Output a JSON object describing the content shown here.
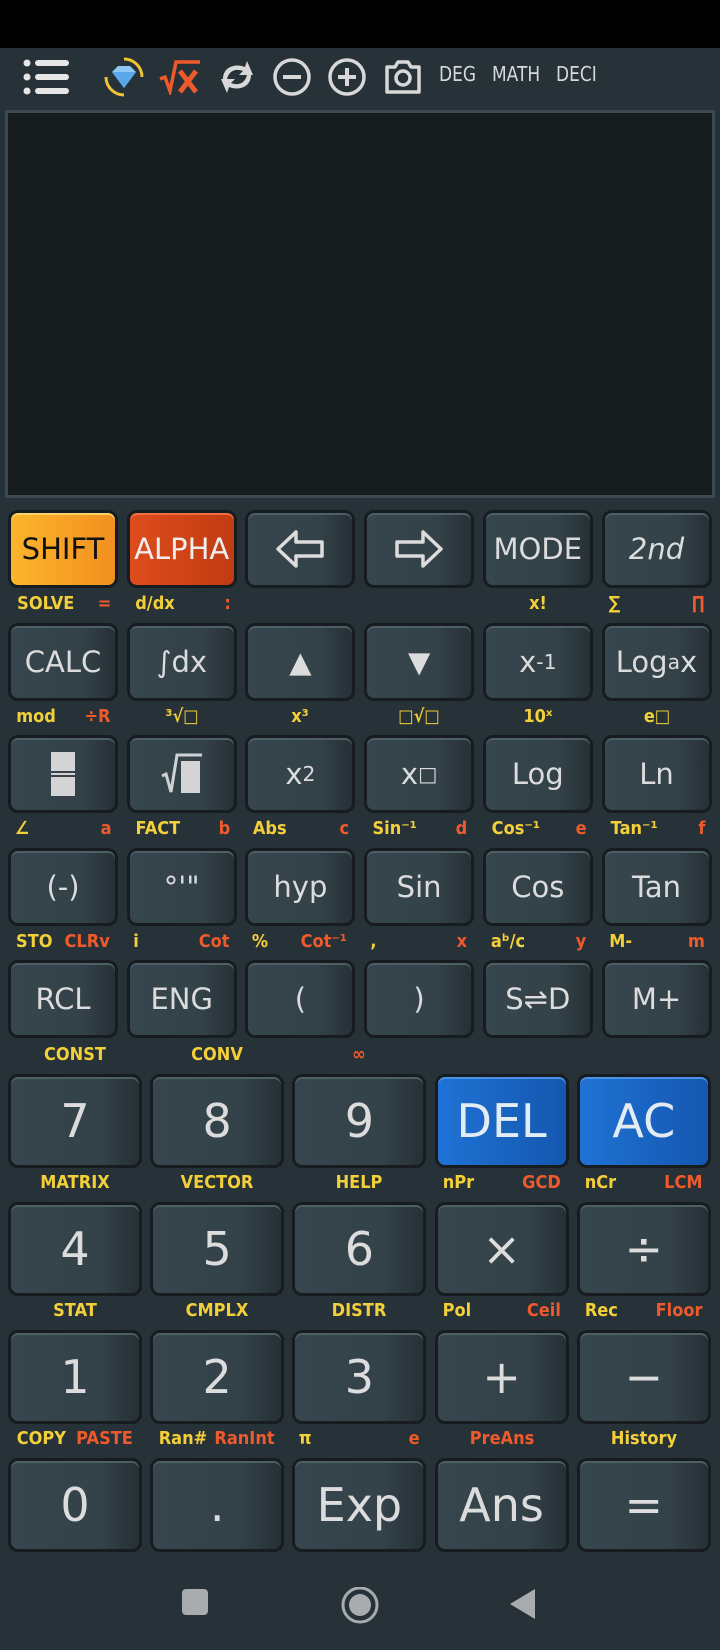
{
  "toolbar": {
    "icons": [
      "menu-icon",
      "premium-diamond-icon",
      "sqrt-x-icon",
      "refresh-icon",
      "zoom-out-icon",
      "zoom-in-icon",
      "camera-icon"
    ],
    "angle_mode": "DEG",
    "input_mode": "MATH",
    "output_mode": "DECI"
  },
  "display": {
    "content": ""
  },
  "colors": {
    "background": "#263238",
    "shift": "#f5a623",
    "alpha": "#d4461a",
    "blue_key": "#1a66c6",
    "shift_label": "#f3cf3a",
    "alpha_label": "#ee5a2c"
  },
  "small_keys": [
    [
      {
        "label": "SHIFT",
        "style": "shift"
      },
      {
        "label": "ALPHA",
        "style": "alpha"
      },
      {
        "icon": "arrow-left-icon"
      },
      {
        "icon": "arrow-right-icon"
      },
      {
        "label": "MODE"
      },
      {
        "label": "2nd",
        "style": "italic"
      }
    ],
    [
      {
        "label": "CALC"
      },
      {
        "label": "∫dx"
      },
      {
        "label": "▲"
      },
      {
        "label": "▼"
      },
      {
        "label": "x",
        "sup": "-1"
      },
      {
        "label": "Log",
        "sub": "a",
        "after": "x"
      }
    ],
    [
      {
        "icon": "fraction-icon"
      },
      {
        "icon": "sqrt-icon"
      },
      {
        "label": "x",
        "sup": "2"
      },
      {
        "label": "x",
        "sup": "□"
      },
      {
        "label": "Log"
      },
      {
        "label": "Ln"
      }
    ],
    [
      {
        "label": "(-)"
      },
      {
        "label": "°'\""
      },
      {
        "label": "hyp"
      },
      {
        "label": "Sin"
      },
      {
        "label": "Cos"
      },
      {
        "label": "Tan"
      }
    ],
    [
      {
        "label": "RCL"
      },
      {
        "label": "ENG"
      },
      {
        "label": "("
      },
      {
        "label": ")"
      },
      {
        "label": "S⇌D"
      },
      {
        "label": "M+"
      }
    ]
  ],
  "small_labels": [
    [
      [
        "SOLVE",
        "="
      ],
      [
        "d/dx",
        ":"
      ],
      [
        "",
        ""
      ],
      [
        "",
        ""
      ],
      [
        "x!",
        ""
      ],
      [
        "∑",
        "∏"
      ]
    ],
    [
      [
        "mod",
        "÷R"
      ],
      [
        "³√□",
        ""
      ],
      [
        "x³",
        ""
      ],
      [
        "□√□",
        ""
      ],
      [
        "10ˣ",
        ""
      ],
      [
        "e□",
        ""
      ]
    ],
    [
      [
        "∠",
        "a"
      ],
      [
        "FACT",
        "b"
      ],
      [
        "Abs",
        "c"
      ],
      [
        "Sin⁻¹",
        "d"
      ],
      [
        "Cos⁻¹",
        "e"
      ],
      [
        "Tan⁻¹",
        "f"
      ]
    ],
    [
      [
        "STO",
        "CLRv"
      ],
      [
        "i",
        "Cot"
      ],
      [
        "%",
        "Cot⁻¹"
      ],
      [
        ",",
        "x"
      ],
      [
        "aᵇ/c",
        "y"
      ],
      [
        "M-",
        "m"
      ]
    ]
  ],
  "big_labels": [
    [
      [
        "CONST",
        ""
      ],
      [
        "CONV",
        ""
      ],
      [
        "",
        "∞"
      ],
      [
        "",
        ""
      ],
      [
        "",
        ""
      ]
    ],
    [
      [
        "MATRIX",
        ""
      ],
      [
        "VECTOR",
        ""
      ],
      [
        "HELP",
        ""
      ],
      [
        "nPr",
        "GCD"
      ],
      [
        "nCr",
        "LCM"
      ]
    ],
    [
      [
        "STAT",
        ""
      ],
      [
        "CMPLX",
        ""
      ],
      [
        "DISTR",
        ""
      ],
      [
        "Pol",
        "Ceil"
      ],
      [
        "Rec",
        "Floor"
      ]
    ],
    [
      [
        "COPY",
        "PASTE"
      ],
      [
        "Ran#",
        "RanInt"
      ],
      [
        "π",
        "e"
      ],
      [
        "",
        "PreAns"
      ],
      [
        "History",
        ""
      ]
    ]
  ],
  "big_keys": [
    [
      {
        "label": "7"
      },
      {
        "label": "8"
      },
      {
        "label": "9"
      },
      {
        "label": "DEL",
        "style": "blue"
      },
      {
        "label": "AC",
        "style": "blue"
      }
    ],
    [
      {
        "label": "4"
      },
      {
        "label": "5"
      },
      {
        "label": "6"
      },
      {
        "label": "×"
      },
      {
        "label": "÷"
      }
    ],
    [
      {
        "label": "1"
      },
      {
        "label": "2"
      },
      {
        "label": "3"
      },
      {
        "label": "+"
      },
      {
        "label": "−"
      }
    ],
    [
      {
        "label": "0"
      },
      {
        "label": "."
      },
      {
        "label": "Exp"
      },
      {
        "label": "Ans"
      },
      {
        "label": "="
      }
    ]
  ],
  "navbar": {
    "icons": [
      "recents-square-icon",
      "home-circle-icon",
      "back-triangle-icon"
    ]
  }
}
